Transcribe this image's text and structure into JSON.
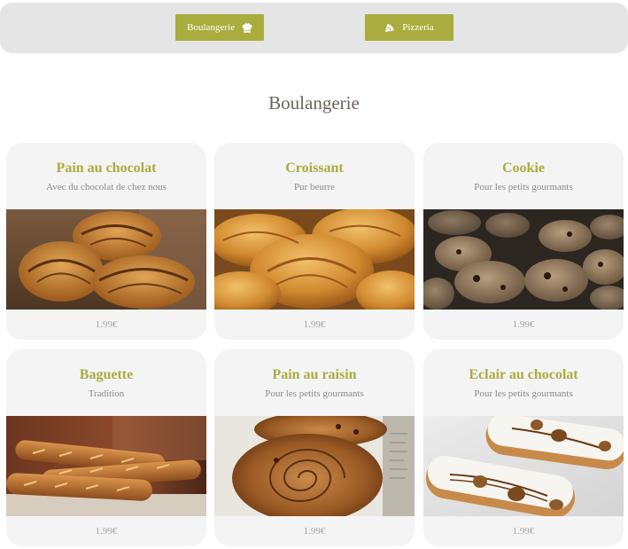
{
  "nav": {
    "boulangerie_label": "Boulangerie",
    "pizzeria_label": "Pizzeria"
  },
  "section": {
    "title": "Boulangerie"
  },
  "products": [
    {
      "name": "Pain au chocolat",
      "description": "Avec du chocolat de chez nous",
      "price": "1.99€",
      "image_icon": "pain-au-chocolat-photo"
    },
    {
      "name": "Croissant",
      "description": "Pur beurre",
      "price": "1.99€",
      "image_icon": "croissant-photo"
    },
    {
      "name": "Cookie",
      "description": "Pour les petits gourmants",
      "price": "1.99€",
      "image_icon": "cookie-photo"
    },
    {
      "name": "Baguette",
      "description": "Tradition",
      "price": "1.99€",
      "image_icon": "baguette-photo"
    },
    {
      "name": "Pain au raisin",
      "description": "Pour les petits gourmants",
      "price": "1.99€",
      "image_icon": "pain-au-raisin-photo"
    },
    {
      "name": "Eclair au chocolat",
      "description": "Pour les petits gourmants",
      "price": "1.99€",
      "image_icon": "eclair-photo"
    }
  ],
  "colors": {
    "accent": "#a8ad3d",
    "nav_bg": "#e5e5e5",
    "card_bg": "#f4f4f4",
    "title": "#6b635a"
  }
}
